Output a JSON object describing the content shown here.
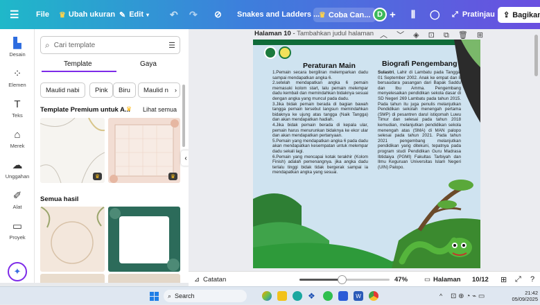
{
  "topbar": {
    "menu_icon": "hamburger-icon",
    "file": "File",
    "resize": "Ubah ukuran",
    "edit": "Edit",
    "doc_title": "Snakes and Ladders ...",
    "try_canva": "Coba Can...",
    "avatar_letter": "D",
    "preview": "Pratinjau",
    "share": "Bagikan"
  },
  "rail": [
    {
      "label": "Desain",
      "icon": "design-icon"
    },
    {
      "label": "Elemen",
      "icon": "elements-icon"
    },
    {
      "label": "Teks",
      "icon": "text-icon"
    },
    {
      "label": "Merek",
      "icon": "brand-icon"
    },
    {
      "label": "Unggahan",
      "icon": "upload-icon"
    },
    {
      "label": "Alat",
      "icon": "draw-icon"
    },
    {
      "label": "Proyek",
      "icon": "folder-icon"
    }
  ],
  "panel": {
    "search_placeholder": "Cari template",
    "tabs": [
      "Template",
      "Gaya"
    ],
    "chips": [
      "Maulid nabi",
      "Pink",
      "Biru",
      "Maulid n"
    ],
    "premium_title": "Template Premium untuk A...",
    "see_all": "Lihat semua",
    "all_results": "Semua hasil"
  },
  "canvas": {
    "page_label": "Halaman 10",
    "page_title_hint": "Tambahkan judul halaman",
    "left_heading": "Peraturan Main",
    "right_heading": "Biografi Pengembang",
    "rules": [
      "1.Pemain secara bergiliran melemparkan dadu sampai mendapatkan angka 6.",
      "2.setelah mendapatkan angka 6 pemain memasuki kolom start, lalu pemain melempar dadu kembali dan memindahkan bidaknya sesuai dengan angka yang muncul pada dadu.",
      "3.Jika bidak pemain berada di bagian bawah tangga pemain tersebut langsun memindahkan bidaknya ke ujung atas tangga (Naik Tangga) dan akan mendapatkan hadiah.",
      "4.Jika bidak pemain berada di kepala ular, pemain harus menurunkan bidaknya ke ekor ular dan akan mendapatkan pertanyaan.",
      "5.Pemain yang mendapatkan angka 6 pada dadu akan mendapatkan kesempatan untuk melempar dadu sekali lagi.",
      "6.Pemain yang mencapai kotak terakhir (Kolom Finish) adalah pemenangnya. jika angka dadu terlalu tinggi bidak tidak bergerak sampai ia mendapatkan angka yang sesuai."
    ],
    "bio_name": "Sulastri",
    "bio_text": ", Lahir di Lambatu pada Tanggal 01 September 2002. Anak ke empat dan 8 bersaudara pasangan dari Bapak Saddu dan Ibu Amma. Pengembang menyelesaikan pendidikan sekola dasar di SD Negeri 269 Lambatu pada tahun 2015. Pada tahun itu juga penulis melanjutkan Pendidikan sekolah menengah pertama (SMP) di pesantren darul istiqomah Luwu Timur dan selesai pada tahun 2018 kemudian, melanjutkan pendidikan sekola menengah atas (SMA) di MAN palopo selesai pada tahun 2021. Pada tahun 2021 pengembang melanjutkan pendidikan yang ditekuni, tepatnya pada program studi Pendidikan Guru Madrasa Ibtidaiya (PGMI) Fakultas Tarbiyah dan Ilmu Keguruan Universitas Islam Negeri (UIN) Palopo."
  },
  "bottombar": {
    "notes": "Catatan",
    "zoom": "47%",
    "pages_label": "Halaman",
    "page_count": "10/12",
    "zoom_fraction": 0.47
  },
  "taskbar": {
    "search": "Search",
    "time": "21:42",
    "date": "05/09/2025"
  },
  "colors": {
    "accent": "#7d2ae8",
    "topbar_start": "#1fb8c9",
    "topbar_end": "#6a4fe0",
    "page_bg": "#cfe3f0",
    "grass": "#2e9a3a"
  }
}
